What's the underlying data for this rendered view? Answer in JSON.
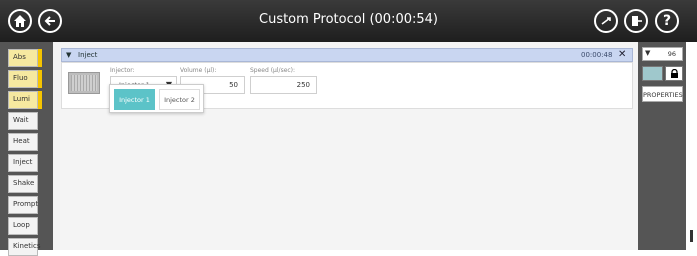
{
  "window": {
    "title": "Custom Protocol (00:00:54)"
  },
  "colors": {
    "accent_yellow": "#f5c400",
    "step_header_blue": "#c9d6f1",
    "selected_teal": "#5cc3c8",
    "topbar": "#2b2b2b"
  },
  "sidebar": {
    "items": [
      {
        "label": "Abs"
      },
      {
        "label": "Fluo"
      },
      {
        "label": "Lumi"
      },
      {
        "label": "Wait"
      },
      {
        "label": "Heat"
      },
      {
        "label": "Inject"
      },
      {
        "label": "Shake"
      },
      {
        "label": "Prompt"
      },
      {
        "label": "Loop"
      },
      {
        "label": "Kinetics"
      }
    ]
  },
  "step": {
    "title": "Inject",
    "time": "00:00:48",
    "injector_label": "Injector:",
    "injector_value": "Injector 1",
    "volume_label": "Volume (µl):",
    "volume_value": "50",
    "speed_label": "Speed (µl/sec):",
    "speed_value": "250",
    "dropdown_options": [
      "Injector 1",
      "Injector 2"
    ]
  },
  "right_panel": {
    "count_value": "96",
    "properties_label": "PROPERTIES"
  }
}
